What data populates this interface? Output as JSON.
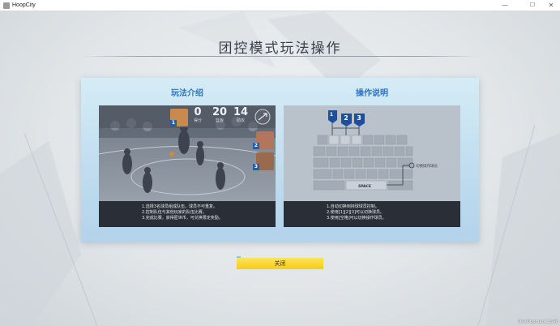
{
  "window": {
    "title": "HoopCity",
    "controls": {
      "minimize": "—",
      "maximize": "☐",
      "close": "✕"
    }
  },
  "page": {
    "title": "团控模式玩法操作",
    "close_label": "关闭",
    "watermark": "Development Build"
  },
  "gameplay": {
    "title": "玩法介绍",
    "scoreboard": [
      {
        "value": "0",
        "label": "得分"
      },
      {
        "value": "20",
        "label": "篮板"
      },
      {
        "value": "14",
        "label": "助攻"
      }
    ],
    "player_badges": [
      "1",
      "2",
      "3"
    ],
    "description": [
      "1.选择3名球员组成队伍，球员不可重复。",
      "2.控制队伍与其他玩家的队伍比赛。",
      "3.完成比赛，获得匿世币，可兑换限定奖励。"
    ]
  },
  "controls": {
    "title": "操作说明",
    "key_badges": [
      "1",
      "2",
      "3"
    ],
    "switch_label": "切换操作球员",
    "space_label": "SPACE",
    "description": [
      "1.自动切换到持球球员控制。",
      "2.使用[1][2][3]可以切换球员。",
      "3.使用[空格]可以切换操作球员。"
    ]
  },
  "colors": {
    "accent_blue": "#2f74bf",
    "button_yellow": "#f6cc1a",
    "panel_dark": "#2a2f37"
  }
}
